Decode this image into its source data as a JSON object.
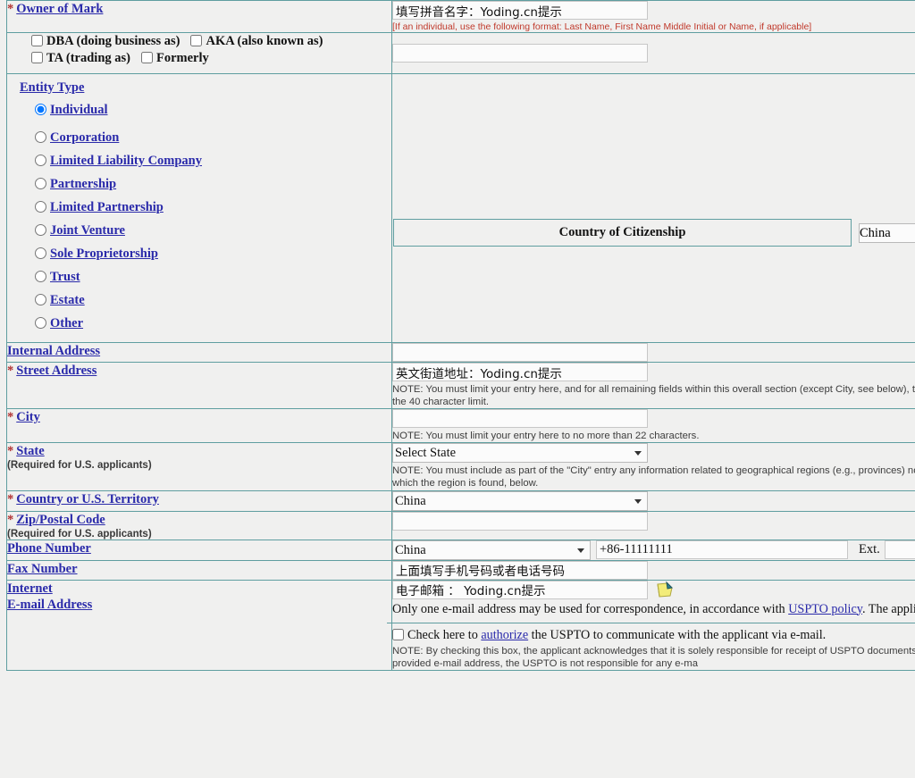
{
  "owner": {
    "label": "Owner of Mark",
    "required_marker": "*",
    "name_value": "填写拼音名字：Yoding.cn提示",
    "name_hint": "[If an individual, use the following format: Last Name, First Name Middle Initial or Name, if applicable]",
    "alt_name_value": ""
  },
  "aliases": {
    "dba": "DBA (doing business as)",
    "aka": "AKA (also known as)",
    "ta": "TA (trading as)",
    "formerly": "Formerly",
    "dba_checked": false,
    "aka_checked": false,
    "ta_checked": false,
    "formerly_checked": false
  },
  "entity": {
    "heading": "Entity Type",
    "selected": "Individual",
    "options": [
      "Individual",
      "Corporation",
      "Limited Liability Company",
      "Partnership",
      "Limited Partnership",
      "Joint Venture",
      "Sole Proprietorship",
      "Trust",
      "Estate",
      "Other"
    ],
    "citizenship_header": "Country of Citizenship",
    "citizenship_value": "China"
  },
  "address": {
    "internal_label": "Internal Address",
    "internal_value": "",
    "street_label": "Street Address",
    "street_value": "英文街道地址：Yoding.cn提示",
    "street_note": "NOTE: You must limit your entry here, and for all remaining fields within this overall section (except City, see below), to no more than 40 characters; otherwise, the entry may result in an undeliverable address, due to truncation at the 40 character limit.",
    "city_label": "City",
    "city_value": "",
    "city_note": "NOTE: You must limit your entry here to no more than 22 characters.",
    "state_label": "State",
    "state_sublabel": "(Required for U.S. applicants)",
    "state_value": "Select State",
    "state_note": "NOTE: You must include as part of the \"City\" entry any information related to geographical regions (e.g., provinces) not found in the drop-down list below; in most instances, you will then also have to select the country within which the region is found, below.",
    "country_label": "Country or U.S. Territory",
    "country_value": "China",
    "zip_label": "Zip/Postal Code",
    "zip_sublabel": "(Required for U.S. applicants)",
    "zip_value": ""
  },
  "contact": {
    "phone_label": "Phone Number",
    "phone_country_value": "China",
    "phone_value": "+86-11111111",
    "ext_label": "Ext.",
    "ext_value": "",
    "fax_label": "Fax Number",
    "fax_value": "上面填写手机号码或者电话号码"
  },
  "email": {
    "label_line1": "Internet",
    "label_line2": "E-mail Address",
    "value": "电子邮箱 ： Yoding.cn提示",
    "icon": "sticky-note-icon",
    "policy_prefix": "Only one e-mail address may be used for correspondence, in accordance with ",
    "policy_link": "USPTO policy",
    "policy_suffix": ". The applic",
    "authorize_prefix": "Check here to ",
    "authorize_link": "authorize",
    "authorize_suffix": " the USPTO to communicate with the applicant via e-mail.",
    "authorize_checked": false,
    "authorize_note": "NOTE: By checking this box, the applicant acknowledges that it is solely responsible for receipt of USPTO documents sent via e-mail, including when the USPTO has e-mailed an Office action. If an action has been sent to the provided e-mail address, the USPTO is not responsible for any e-ma"
  },
  "colors": {
    "border": "#5f9ea0",
    "background": "#f0f0ef",
    "link": "#2a2aaa",
    "required": "#b03030",
    "hint": "#c0392b"
  }
}
